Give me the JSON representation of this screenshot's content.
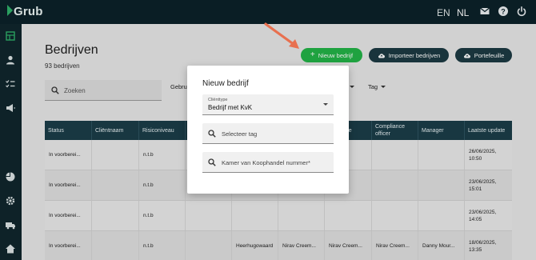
{
  "app": {
    "logo_text": "Grub",
    "brand_color": "#23b347",
    "header_bg": "#0c2129"
  },
  "topbar": {
    "languages": [
      "EN",
      "NL"
    ],
    "icons": [
      "mail-icon",
      "help-icon",
      "power-icon"
    ]
  },
  "sidebar": {
    "icons": [
      "dashboard-icon",
      "user-icon",
      "checklist-icon",
      "megaphone-icon",
      "pie-chart-icon",
      "settings-icon",
      "truck-icon",
      "home-icon"
    ]
  },
  "page": {
    "title": "Bedrijven",
    "count": "93 bedrijven",
    "buttons": {
      "new": "Nieuw bedrijf",
      "import": "Importeer bedrijven",
      "portfolio": "Portefeuille"
    },
    "search_placeholder": "Zoeken",
    "filters": [
      "Gebrui",
      "Tag"
    ]
  },
  "table": {
    "headers": [
      "Status",
      "Cliëntnaam",
      "Risiconiveau",
      "",
      "",
      "",
      "beheerde",
      "Compliance officer",
      "Manager",
      "Laatste update"
    ],
    "rows": [
      [
        "In voorberei...",
        "",
        "n.t.b",
        "",
        "",
        "",
        "",
        "",
        "",
        "26/06/2025, 10:50"
      ],
      [
        "In voorberei...",
        "",
        "n.t.b",
        "",
        "",
        "",
        "",
        "",
        "",
        "23/06/2025, 15:01"
      ],
      [
        "In voorberei...",
        "",
        "n.t.b",
        "",
        "",
        "",
        "",
        "",
        "",
        "23/06/2025, 14:05"
      ],
      [
        "In voorberei...",
        "",
        "n.t.b",
        "",
        "Heerhugowaard",
        "Nirav Creem...",
        "Nirav Creem...",
        "Nirav Creem...",
        "Danny Mour...",
        "18/06/2025, 13:35"
      ]
    ]
  },
  "modal": {
    "title": "Nieuw bedrijf",
    "clienttype_label": "Cliënttype",
    "clienttype_value": "Bedrijf met KvK",
    "tag_placeholder": "Selecteer tag",
    "kvk_placeholder": "Kamer van Koophandel nummer*"
  }
}
